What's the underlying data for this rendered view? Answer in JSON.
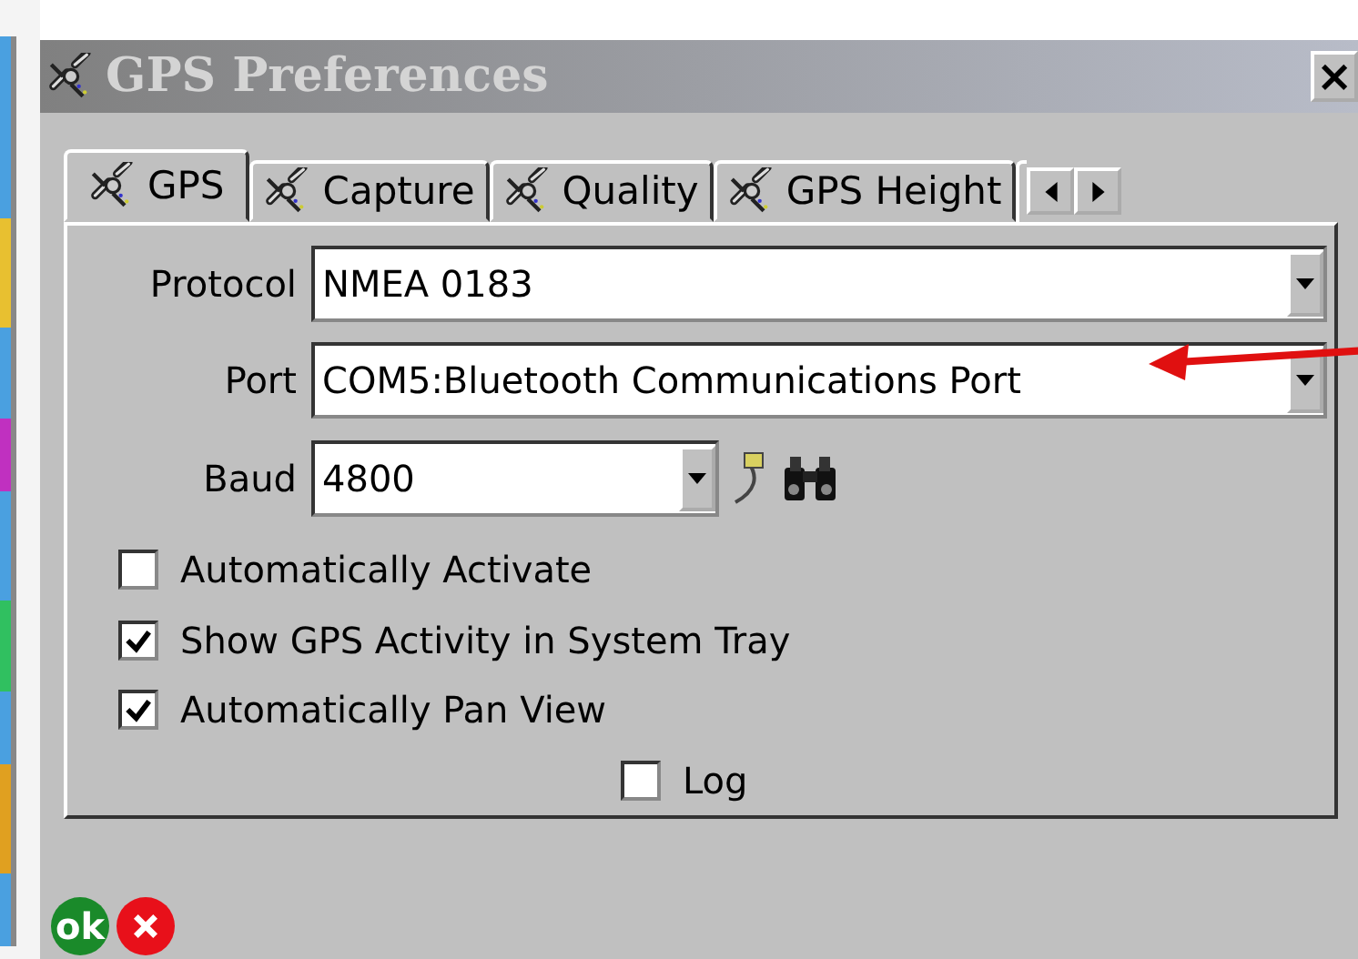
{
  "window": {
    "title": "GPS Preferences",
    "close": "×"
  },
  "tabs": [
    {
      "label": "GPS",
      "selected": true
    },
    {
      "label": "Capture",
      "selected": false
    },
    {
      "label": "Quality",
      "selected": false
    },
    {
      "label": "GPS Height",
      "selected": false
    }
  ],
  "fields": [
    {
      "label": "Protocol",
      "value": "NMEA 0183",
      "kind": "wide"
    },
    {
      "label": "Port",
      "value": "COM5:Bluetooth Communications Port",
      "kind": "wide"
    },
    {
      "label": "Baud",
      "value": "4800",
      "kind": "narrow"
    }
  ],
  "options": [
    {
      "label": "Automatically Activate",
      "checked": false
    },
    {
      "label": "Show GPS Activity in System Tray",
      "checked": true
    },
    {
      "label": "Automatically Pan View",
      "checked": true
    },
    {
      "label": "Log",
      "checked": false
    }
  ],
  "ok_button": "ok"
}
